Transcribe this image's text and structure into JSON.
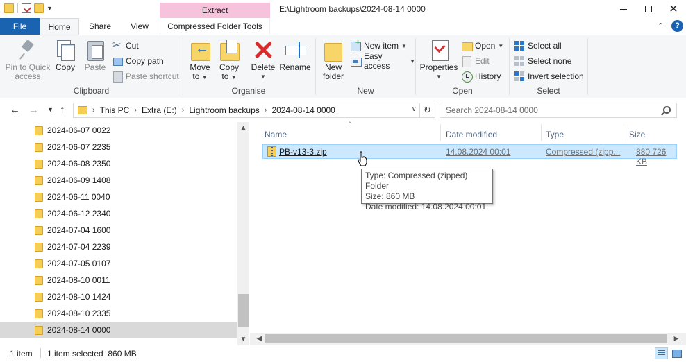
{
  "window": {
    "title": "E:\\Lightroom backups\\2024-08-14 0000",
    "context_tab_header": "Extract",
    "controls": {
      "minimize": "minimize",
      "maximize": "maximize",
      "close": "✕"
    }
  },
  "ribbon_tabs": {
    "file": "File",
    "home": "Home",
    "share": "Share",
    "view": "View",
    "compressed_tools": "Compressed Folder Tools",
    "active": "Home"
  },
  "ribbon": {
    "clipboard": {
      "label": "Clipboard",
      "pin": "Pin to Quick access",
      "pin_line1": "Pin to Quick",
      "pin_line2": "access",
      "copy": "Copy",
      "paste": "Paste",
      "cut": "Cut",
      "copy_path": "Copy path",
      "paste_shortcut": "Paste shortcut"
    },
    "organise": {
      "label": "Organise",
      "move_to_line1": "Move",
      "move_to_line2": "to",
      "copy_to_line1": "Copy",
      "copy_to_line2": "to",
      "delete": "Delete",
      "rename": "Rename"
    },
    "new": {
      "label": "New",
      "new_folder_line1": "New",
      "new_folder_line2": "folder",
      "new_item": "New item",
      "easy_access": "Easy access"
    },
    "open": {
      "label": "Open",
      "properties": "Properties",
      "open": "Open",
      "edit": "Edit",
      "history": "History"
    },
    "select": {
      "label": "Select",
      "select_all": "Select all",
      "select_none": "Select none",
      "invert_selection": "Invert selection"
    }
  },
  "address_bar": {
    "breadcrumbs": [
      "This PC",
      "Extra (E:)",
      "Lightroom backups",
      "2024-08-14 0000"
    ],
    "search_placeholder": "Search 2024-08-14 0000"
  },
  "nav_tree": {
    "items": [
      "2024-06-07 0022",
      "2024-06-07 2235",
      "2024-06-08 2350",
      "2024-06-09 1408",
      "2024-06-11 0040",
      "2024-06-12 2340",
      "2024-07-04 1600",
      "2024-07-04 2239",
      "2024-07-05 0107",
      "2024-08-10 0011",
      "2024-08-10 1424",
      "2024-08-10 2335",
      "2024-08-14 0000"
    ],
    "selected": "2024-08-14 0000"
  },
  "file_list": {
    "columns": {
      "name": "Name",
      "date_modified": "Date modified",
      "type": "Type",
      "size": "Size"
    },
    "rows": [
      {
        "name": "PB-v13-3.zip",
        "date_modified": "14.08.2024 00:01",
        "type": "Compressed (zipp...",
        "size": "880 726 KB"
      }
    ]
  },
  "tooltip": {
    "type_line": "Type: Compressed (zipped) Folder",
    "size_line": "Size: 860 MB",
    "date_line": "Date modified: 14.08.2024 00:01"
  },
  "status_bar": {
    "item_count": "1 item",
    "selection": "1 item selected  860 MB"
  },
  "colors": {
    "file_tab": "#1a63b0",
    "context_tab": "#f7c3dc",
    "selection": "#cce8ff",
    "selection_border": "#99d1ff"
  }
}
